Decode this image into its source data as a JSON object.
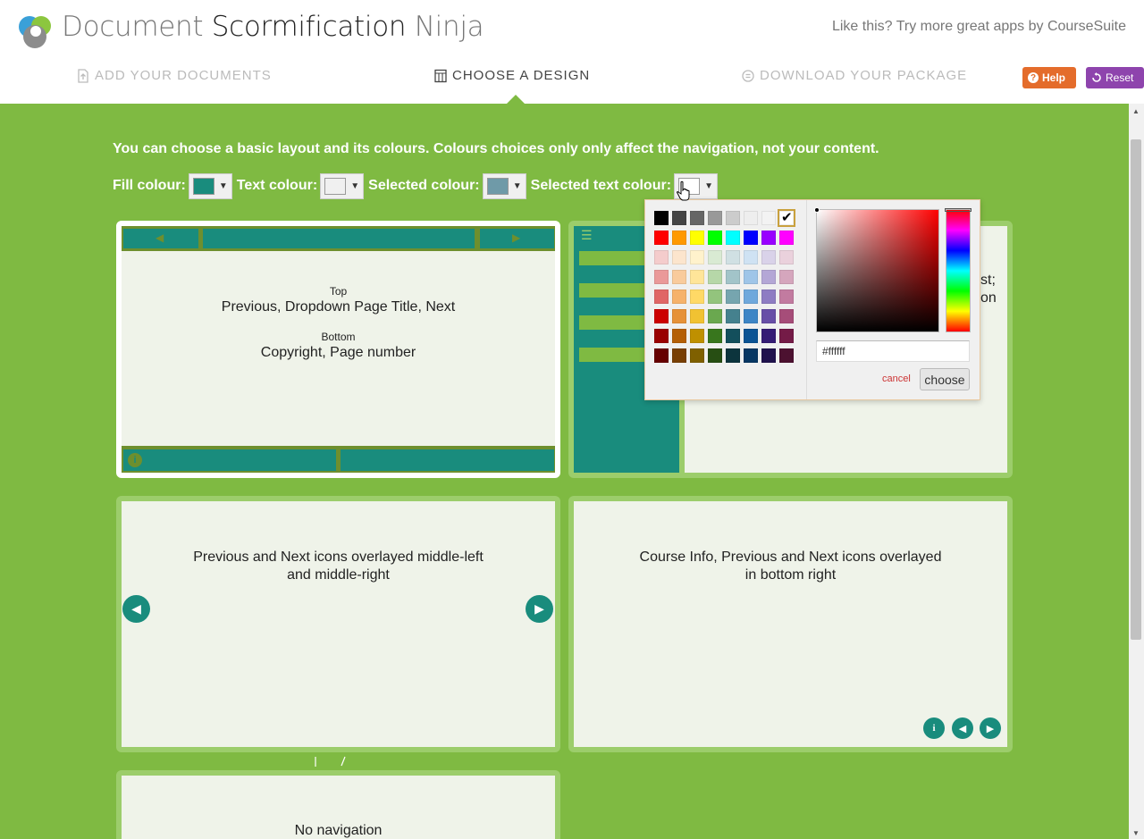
{
  "header": {
    "title_part1": "Document",
    "title_part2": "Scormification",
    "title_part3": "Ninja",
    "tagline": "Like this? Try more great apps by CourseSuite",
    "steps": [
      {
        "label": "ADD YOUR DOCUMENTS",
        "icon": "upload-file-icon",
        "active": false
      },
      {
        "label": "CHOOSE A DESIGN",
        "icon": "layout-grid-icon",
        "active": true
      },
      {
        "label": "DOWNLOAD YOUR PACKAGE",
        "icon": "download-circle-icon",
        "active": false
      }
    ],
    "help_label": "Help",
    "reset_label": "Reset"
  },
  "intro": "You can choose a basic layout and its colours. Colours choices only only affect the navigation, not your content.",
  "colours": {
    "fill_label": "Fill colour:",
    "fill_value": "#198c7d",
    "text_label": "Text colour:",
    "text_value": "#f0f0f0",
    "selected_label": "Selected colour:",
    "selected_value": "#6f9aa8",
    "selected_text_label": "Selected text colour:",
    "selected_text_value": "#ffffff"
  },
  "layouts": [
    {
      "top_label": "Top",
      "top_items": "Previous, Dropdown Page Title, Next",
      "bottom_label": "Bottom",
      "bottom_items": "Copyright, Page number",
      "selected": true
    },
    {
      "partial_line1": "st;",
      "partial_line2": "on"
    },
    {
      "line1": "Previous and Next icons overlayed middle-left",
      "line2": "and middle-right"
    },
    {
      "line1": "Course Info, Previous and Next icons overlayed",
      "line2": "in bottom right"
    },
    {
      "line1": "No navigation"
    }
  ],
  "picker": {
    "hex_value": "#ffffff",
    "cancel_label": "cancel",
    "choose_label": "choose",
    "palette": [
      [
        "#000000",
        "#444444",
        "#666666",
        "#999999",
        "#cccccc",
        "#eeeeee",
        "#f3f3f3",
        "#ffffff"
      ],
      [
        "#ff0000",
        "#ff9900",
        "#ffff00",
        "#00ff00",
        "#00ffff",
        "#0000ff",
        "#9900ff",
        "#ff00ff"
      ],
      [
        "#f4cccc",
        "#fce5cd",
        "#fff2cc",
        "#d9ead3",
        "#d0e0e3",
        "#cfe2f3",
        "#d9d2e9",
        "#ead1dc"
      ],
      [
        "#ea9999",
        "#f9cb9c",
        "#ffe599",
        "#b6d7a8",
        "#a2c4c9",
        "#9fc5e8",
        "#b4a7d6",
        "#d5a6bd"
      ],
      [
        "#e06666",
        "#f6b26b",
        "#ffd966",
        "#93c47d",
        "#76a5af",
        "#6fa8dc",
        "#8e7cc3",
        "#c27ba0"
      ],
      [
        "#cc0000",
        "#e69138",
        "#f1c232",
        "#6aa84f",
        "#45818e",
        "#3d85c6",
        "#674ea7",
        "#a64d79"
      ],
      [
        "#990000",
        "#b45f06",
        "#bf9000",
        "#38761d",
        "#134f5c",
        "#0b5394",
        "#351c75",
        "#741b47"
      ],
      [
        "#660000",
        "#783f04",
        "#7f6000",
        "#274e13",
        "#0c343d",
        "#073763",
        "#20124d",
        "#4c1130"
      ]
    ]
  }
}
